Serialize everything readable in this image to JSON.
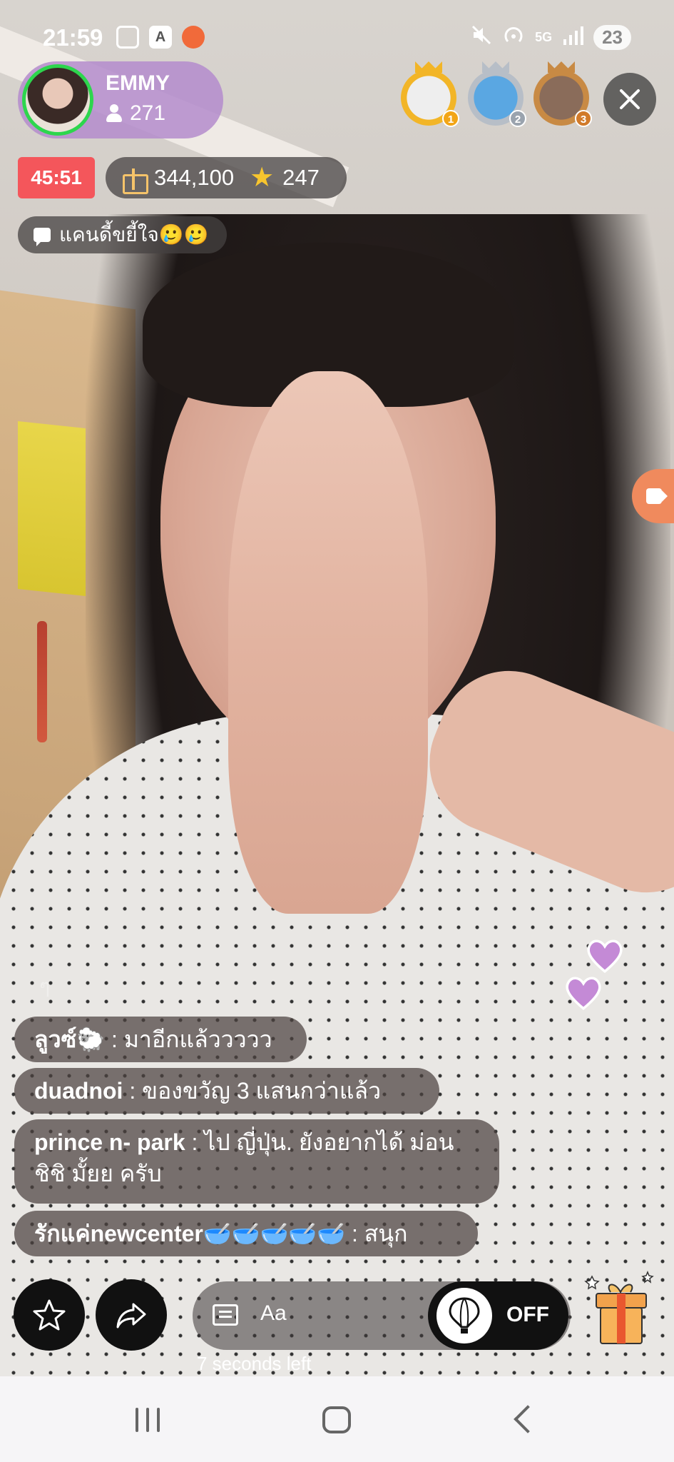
{
  "status_bar": {
    "time": "21:59",
    "network": "5G",
    "battery": "23",
    "icons": [
      "screenshot-icon",
      "app-icon",
      "screen-record-icon",
      "mute-icon",
      "hotspot-icon",
      "signal-icon"
    ]
  },
  "host": {
    "name": "EMMY",
    "viewers": "271",
    "avatar_ring_color": "#2dd64d"
  },
  "top_viewers": [
    {
      "rank": "1",
      "icon": "default-avatar"
    },
    {
      "rank": "2",
      "icon": "doraemon-avatar"
    },
    {
      "rank": "3",
      "icon": "user-photo-avatar"
    }
  ],
  "live": {
    "timer": "45:51",
    "gifts_count": "344,100",
    "stars_count": "247",
    "pinned_message": "แคนดี้ขยี้ใจ🥲🥲"
  },
  "chat": {
    "faded_line": "ๆ",
    "messages": [
      {
        "user": "ลูวซ์🐑",
        "text": " : มาอีกแล้ววววว"
      },
      {
        "user": "duadnoi",
        "text": " : ของขวัญ 3 แสนกว่าแล้ว"
      },
      {
        "user": "prince n- park ",
        "text": " : ไป ญี่ปุ่น. ยังอยากได้ ม่อน ชิชิ มั้ยย ครับ"
      },
      {
        "user": "รักแค่newcenter🥣🥣🥣🥣🥣",
        "text": " : สนุก"
      }
    ]
  },
  "controls": {
    "comment_placeholder": "Aa",
    "balloon_toggle_label": "OFF",
    "countdown": "7 seconds left"
  },
  "colors": {
    "timer_bg": "#f4565b",
    "host_chip_bg": "#b48ccd",
    "heart": "#c48ad6",
    "side_tab": "#f08a5d"
  }
}
